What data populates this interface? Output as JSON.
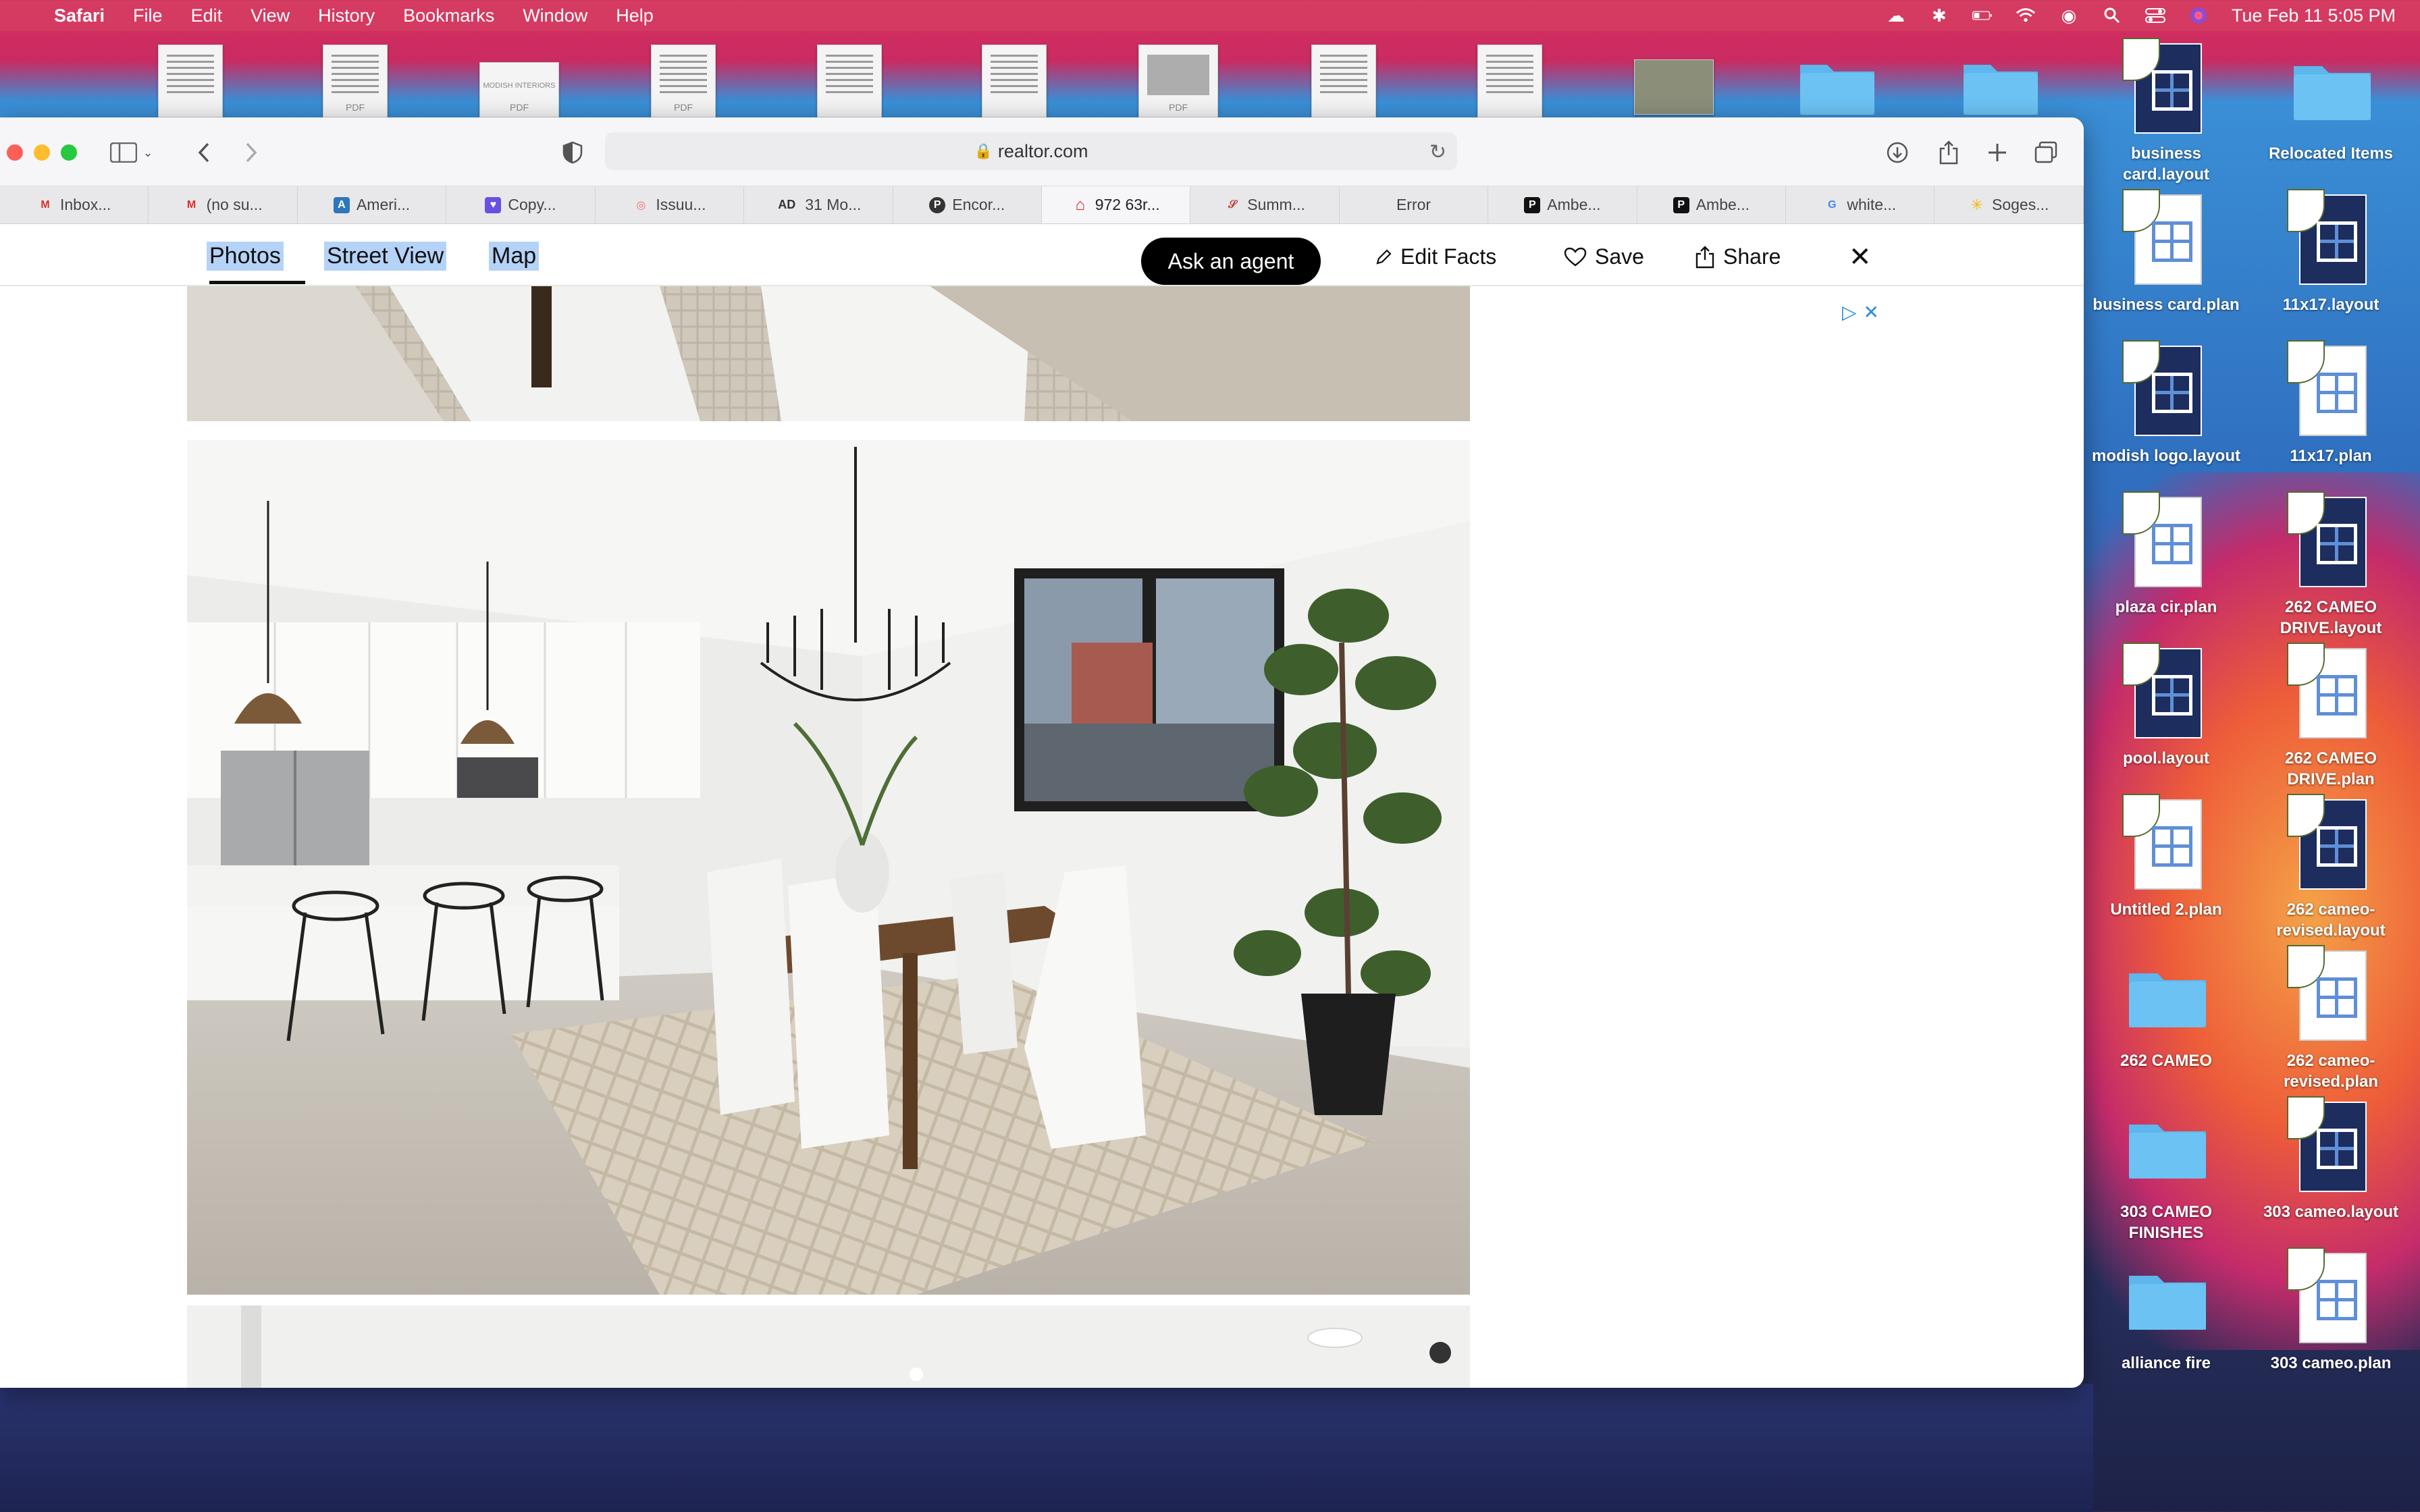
{
  "menubar": {
    "apple": "",
    "app": "Safari",
    "items": [
      "File",
      "Edit",
      "View",
      "History",
      "Bookmarks",
      "Window",
      "Help"
    ],
    "datetime": "Tue Feb 11  5:05 PM"
  },
  "desktop_strip": {
    "pdf_tag": "PDF",
    "modish_label": "MODISH INTERIORS"
  },
  "browser": {
    "address": "realtor.com",
    "tabs": [
      {
        "label": "Inbox...",
        "icon": "gmail-icon",
        "color": "#d93025",
        "glyph": "M"
      },
      {
        "label": "(no su...",
        "icon": "gmail-icon",
        "color": "#d93025",
        "glyph": "M"
      },
      {
        "label": "Ameri...",
        "icon": "amex-icon",
        "color": "#2e77bb",
        "glyph": "A"
      },
      {
        "label": "Copy...",
        "icon": "copy-icon",
        "color": "#6b4fe0",
        "glyph": "C"
      },
      {
        "label": "Issuu...",
        "icon": "issuu-icon",
        "color": "#f36d5d",
        "glyph": "◎"
      },
      {
        "label": "31 Mo...",
        "icon": "ad-icon",
        "color": "#ffffff",
        "glyph": "AD"
      },
      {
        "label": "Encor...",
        "icon": "pinterest-icon",
        "color": "#333333",
        "glyph": "P"
      },
      {
        "label": "972 63r...",
        "icon": "realtor-icon",
        "color": "#d92228",
        "glyph": "⌂"
      },
      {
        "label": "Summ...",
        "icon": "script-icon",
        "color": "#ffffff",
        "glyph": "𝒮"
      },
      {
        "label": "Error",
        "icon": "",
        "color": "#ffffff",
        "glyph": ""
      },
      {
        "label": "Ambe...",
        "icon": "p-icon",
        "color": "#111111",
        "glyph": "P"
      },
      {
        "label": "Ambe...",
        "icon": "p-icon",
        "color": "#111111",
        "glyph": "P"
      },
      {
        "label": "white...",
        "icon": "google-icon",
        "color": "#4285f4",
        "glyph": "G"
      },
      {
        "label": "Soges...",
        "icon": "walmart-icon",
        "color": "#f5b800",
        "glyph": "✳"
      }
    ]
  },
  "page": {
    "nav": {
      "photos": "Photos",
      "street_view": "Street View",
      "map": "Map"
    },
    "ask_agent": "Ask an agent",
    "edit_facts": "Edit Facts",
    "save": "Save",
    "share": "Share"
  },
  "desktop_icons": [
    {
      "label": "business card.layout",
      "type": "layout"
    },
    {
      "label": "Relocated Items",
      "type": "folder"
    },
    {
      "label": "business card.plan",
      "type": "plan"
    },
    {
      "label": "11x17.layout",
      "type": "layout"
    },
    {
      "label": "modish logo.layout",
      "type": "layout"
    },
    {
      "label": "11x17.plan",
      "type": "plan"
    },
    {
      "label": "plaza cir.plan",
      "type": "plan"
    },
    {
      "label": "262 CAMEO DRIVE.layout",
      "type": "layout"
    },
    {
      "label": "pool.layout",
      "type": "layout"
    },
    {
      "label": "262 CAMEO DRIVE.plan",
      "type": "plan"
    },
    {
      "label": "Untitled 2.plan",
      "type": "plan"
    },
    {
      "label": "262 cameo-revised.layout",
      "type": "layout"
    },
    {
      "label": "262 CAMEO",
      "type": "folder"
    },
    {
      "label": "262 cameo-revised.plan",
      "type": "plan"
    },
    {
      "label": "303 CAMEO FINISHES",
      "type": "folder"
    },
    {
      "label": "303 cameo.layout",
      "type": "layout"
    },
    {
      "label": "alliance fire",
      "type": "folder"
    },
    {
      "label": "303 cameo.plan",
      "type": "plan"
    }
  ]
}
